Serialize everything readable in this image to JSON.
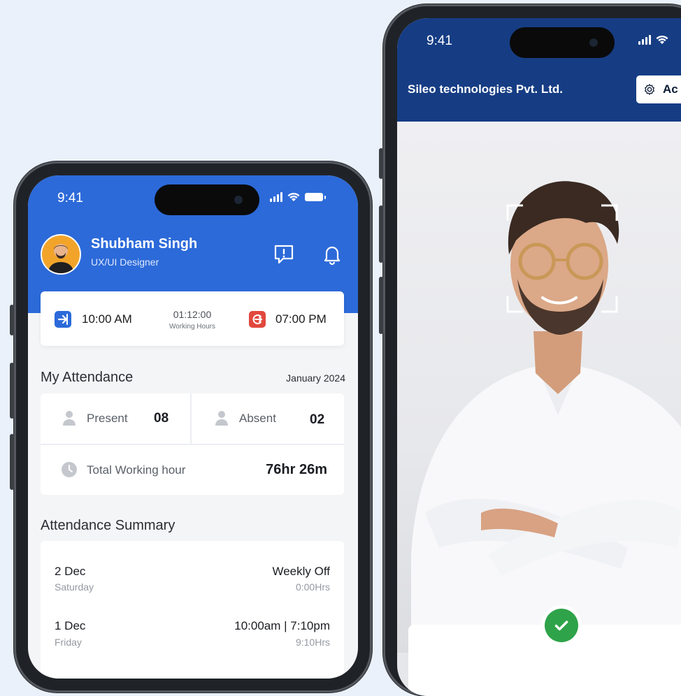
{
  "left_phone": {
    "status": {
      "time": "9:41"
    },
    "user": {
      "name": "Shubham Singh",
      "role": "UX/UI Designer"
    },
    "header_icons": [
      "alert-message-icon",
      "bell-icon"
    ],
    "time_card": {
      "check_in": "10:00 AM",
      "duration": "01:12:00",
      "duration_label": "Working Hours",
      "check_out": "07:00 PM",
      "check_in_color": "#2c6ad9",
      "check_out_color": "#e2483d"
    },
    "attendance": {
      "title": "My Attendance",
      "month": "January 2024",
      "present_label": "Present",
      "present_value": "08",
      "absent_label": "Absent",
      "absent_value": "02",
      "total_label": "Total Working hour",
      "total_value": "76hr 26m"
    },
    "summary": {
      "title": "Attendance Summary",
      "rows": [
        {
          "date": "2 Dec",
          "day": "Saturday",
          "status": "Weekly Off",
          "hours": "0:00Hrs"
        },
        {
          "date": "1 Dec",
          "day": "Friday",
          "status": "10:00am | 7:10pm",
          "hours": "9:10Hrs"
        }
      ]
    }
  },
  "right_phone": {
    "status": {
      "time": "9:41"
    },
    "company": "Sileo technologies Pvt. Ltd.",
    "action_button": {
      "label": "Ac",
      "icon": "gear-icon"
    },
    "success_color": "#2fa34a"
  },
  "colors": {
    "primary_blue": "#2c6ad9",
    "navy": "#163d84",
    "background": "#eaf1fa"
  }
}
